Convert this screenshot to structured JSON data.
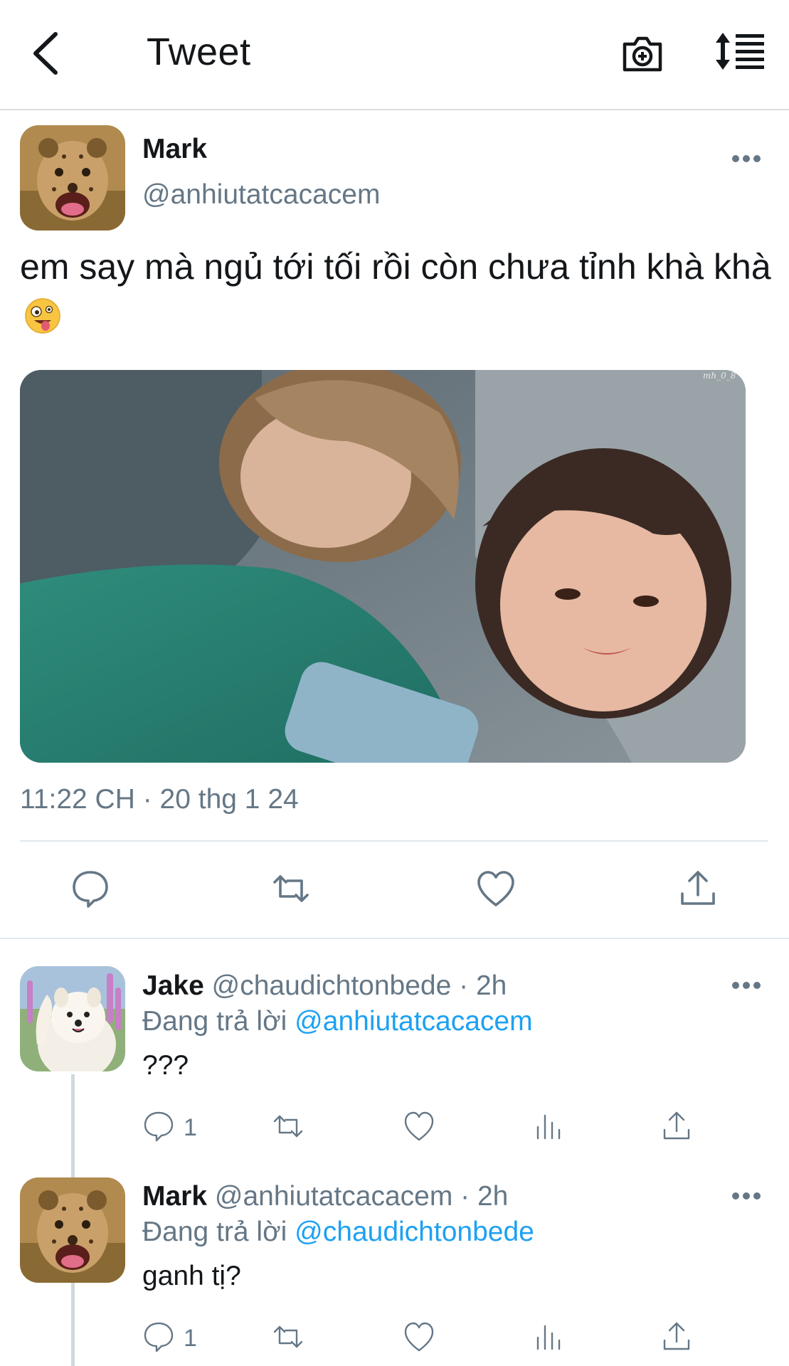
{
  "header": {
    "title": "Tweet",
    "back_icon": "chevron-left-icon",
    "camera_icon": "camera-plus-icon",
    "sort_icon": "sort-list-icon"
  },
  "tweet": {
    "author_name": "Mark",
    "author_handle": "@anhiutatcacacem",
    "text": "em say mà ngủ tới tối rồi còn chưa tỉnh khà khà",
    "emoji": "zany-face-emoji",
    "image_watermark": "mh_0_8",
    "timestamp": "11:22 CH · 20 thg 1 24",
    "actions": [
      "reply-icon",
      "retweet-icon",
      "like-icon",
      "share-icon"
    ]
  },
  "replies": [
    {
      "name": "Jake",
      "handle_time": "@chaudichtonbede · 2h",
      "replying_prefix": "Đang trả lời ",
      "replying_to": "@anhiutatcacacem",
      "text": "???",
      "reply_count": "1"
    },
    {
      "name": "Mark",
      "handle_time": "@anhiutatcacacem · 2h",
      "replying_prefix": "Đang trả lời ",
      "replying_to": "@chaudichtonbede",
      "text": "ganh tị?",
      "reply_count": "1"
    }
  ],
  "colors": {
    "accent": "#1da1f2",
    "secondary_text": "#657786",
    "divider": "#e1e8ed"
  }
}
